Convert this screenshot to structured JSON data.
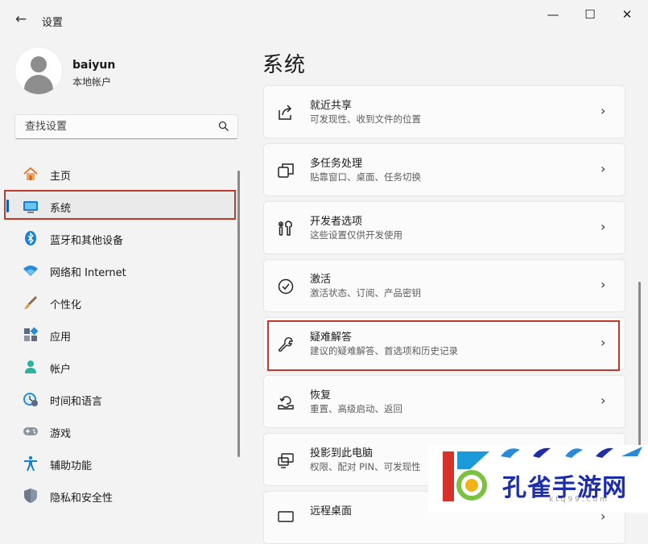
{
  "window": {
    "title": "设置",
    "controls": {
      "minimize": "—",
      "maximize": "☐",
      "close": "✕"
    }
  },
  "user": {
    "name": "baiyun",
    "account_type": "本地帐户"
  },
  "search": {
    "placeholder": "查找设置"
  },
  "nav": {
    "items": [
      {
        "label": "主页",
        "icon": "home-icon"
      },
      {
        "label": "系统",
        "icon": "system-icon",
        "selected": true
      },
      {
        "label": "蓝牙和其他设备",
        "icon": "bluetooth-icon"
      },
      {
        "label": "网络和 Internet",
        "icon": "wifi-icon"
      },
      {
        "label": "个性化",
        "icon": "brush-icon"
      },
      {
        "label": "应用",
        "icon": "apps-icon"
      },
      {
        "label": "帐户",
        "icon": "account-icon"
      },
      {
        "label": "时间和语言",
        "icon": "time-language-icon"
      },
      {
        "label": "游戏",
        "icon": "gamepad-icon"
      },
      {
        "label": "辅助功能",
        "icon": "accessibility-icon"
      },
      {
        "label": "隐私和安全性",
        "icon": "shield-icon"
      }
    ]
  },
  "main": {
    "heading": "系统",
    "cards": [
      {
        "title": "就近共享",
        "subtitle": "可发现性、收到文件的位置",
        "icon": "share-icon"
      },
      {
        "title": "多任务处理",
        "subtitle": "贴靠窗口、桌面、任务切换",
        "icon": "multitask-icon"
      },
      {
        "title": "开发者选项",
        "subtitle": "这些设置仅供开发使用",
        "icon": "developer-icon"
      },
      {
        "title": "激活",
        "subtitle": "激活状态、订阅、产品密钥",
        "icon": "activation-icon"
      },
      {
        "title": "疑难解答",
        "subtitle": "建议的疑难解答、首选项和历史记录",
        "icon": "wrench-icon"
      },
      {
        "title": "恢复",
        "subtitle": "重置、高级启动、返回",
        "icon": "recovery-icon"
      },
      {
        "title": "投影到此电脑",
        "subtitle": "权限、配对 PIN、可发现性",
        "icon": "projection-icon"
      },
      {
        "title": "远程桌面",
        "subtitle": "",
        "icon": "remote-desktop-icon"
      }
    ],
    "chevron": "›"
  },
  "watermark": {
    "text": "孔雀手游网",
    "url": "ktq99.com"
  },
  "colors": {
    "accent": "#005fb8",
    "highlight_box": "#c0392b",
    "background": "#f3f3f3"
  }
}
